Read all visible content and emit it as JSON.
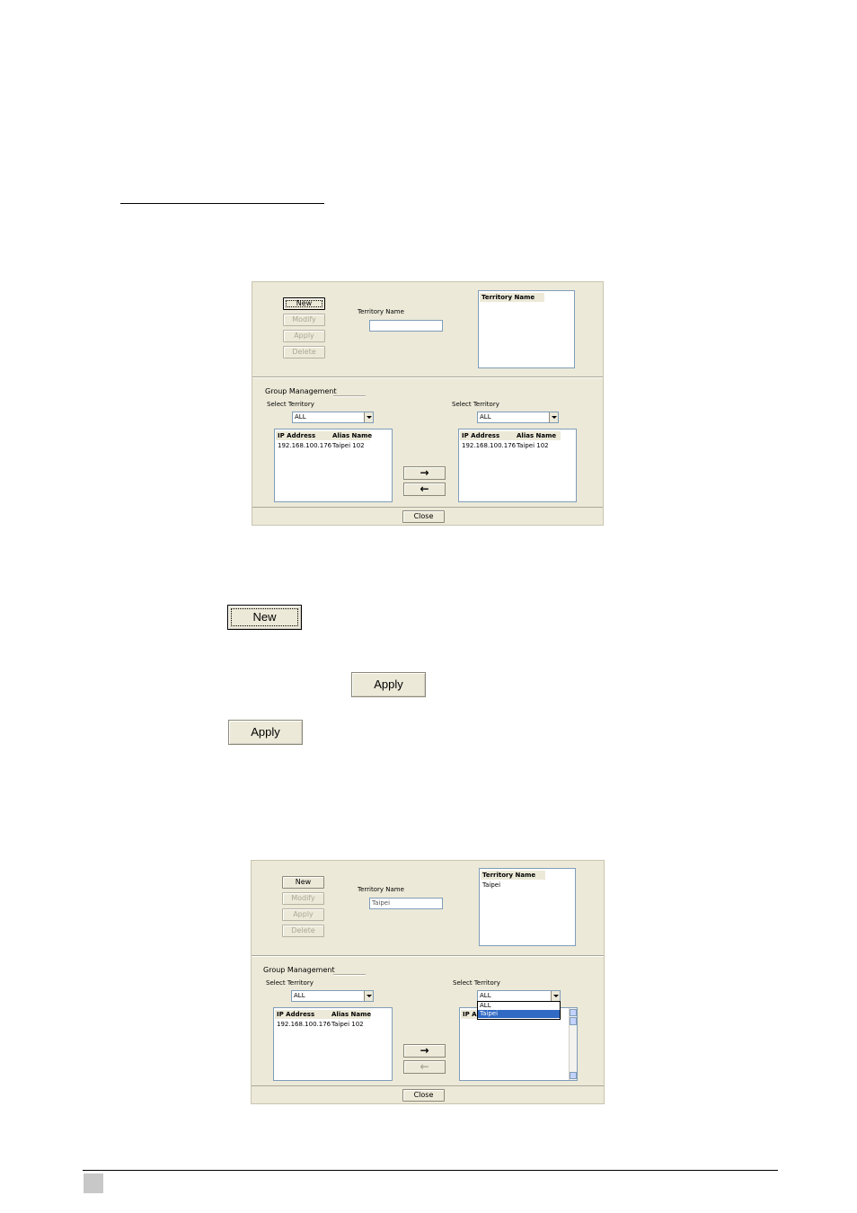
{
  "dialog1": {
    "buttons": {
      "new": "New",
      "modify": "Modify",
      "apply": "Apply",
      "delete": "Delete"
    },
    "territory_name_label": "Territory Name",
    "territory_name_value": "",
    "territory_list_header": "Territory Name",
    "territory_list_items": [],
    "group_management_label": "Group Management",
    "left_select_label": "Select Territory",
    "left_select_value": "ALL",
    "right_select_label": "Select Territory",
    "right_select_value": "ALL",
    "left_list": {
      "headers": [
        "IP Address",
        "Alias Name"
      ],
      "rows": [
        [
          "192.168.100.176",
          "Taipei 102"
        ]
      ]
    },
    "right_list": {
      "headers": [
        "IP Address",
        "Alias Name"
      ],
      "rows": [
        [
          "192.168.100.176",
          "Taipei 102"
        ]
      ]
    },
    "move_right_icon": "arrow-right-icon",
    "move_left_icon": "arrow-left-icon",
    "close_label": "Close"
  },
  "callouts": {
    "new": "New",
    "apply_inline": "Apply",
    "apply": "Apply"
  },
  "dialog2": {
    "buttons": {
      "new": "New",
      "modify": "Modify",
      "apply": "Apply",
      "delete": "Delete"
    },
    "territory_name_label": "Territory Name",
    "territory_name_value": "Taipei",
    "territory_list_header": "Territory Name",
    "territory_list_items": [
      "Taipei"
    ],
    "group_management_label": "Group Management",
    "left_select_label": "Select Territory",
    "left_select_value": "ALL",
    "right_select_label": "Select Territory",
    "right_select_value": "ALL",
    "right_dropdown_options": [
      "ALL",
      "Taipei"
    ],
    "right_dropdown_selected": "Taipei",
    "left_list": {
      "headers": [
        "IP Address",
        "Alias Name"
      ],
      "rows": [
        [
          "192.168.100.176",
          "Taipei 102"
        ]
      ]
    },
    "right_list_header_partial": "IP Ad",
    "close_label": "Close"
  }
}
